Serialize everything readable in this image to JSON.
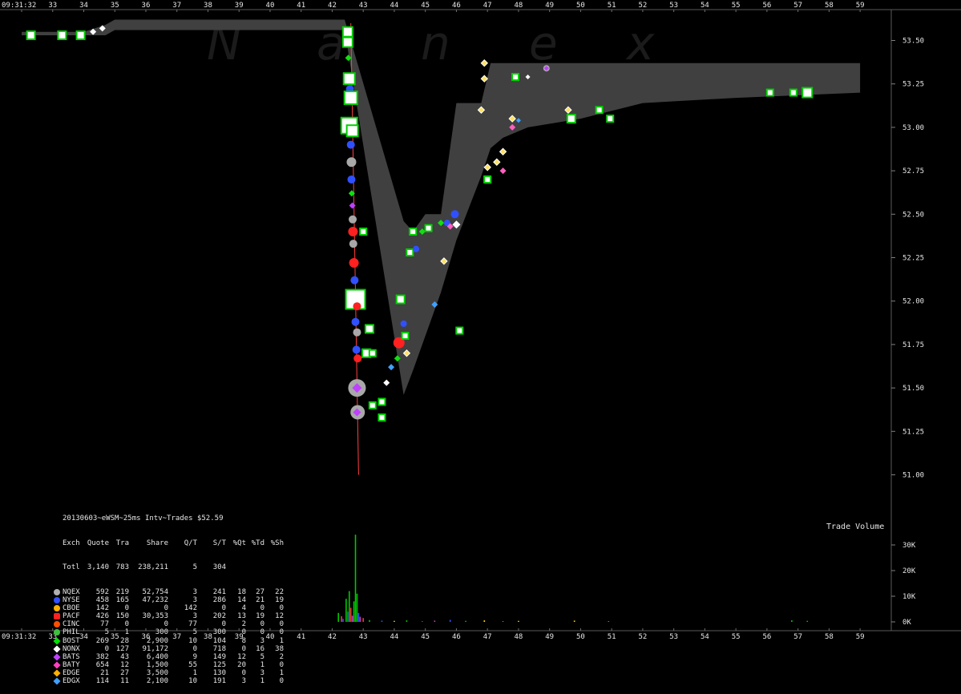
{
  "chart_data": {
    "type": "scatter",
    "title": "20130603~eWSM~25ms Intv~Trades $52.59",
    "watermark": "Nanex",
    "time_labels": [
      "09:31:32",
      "33",
      "34",
      "35",
      "36",
      "37",
      "38",
      "39",
      "40",
      "41",
      "42",
      "43",
      "44",
      "45",
      "46",
      "47",
      "48",
      "49",
      "50",
      "51",
      "52",
      "53",
      "54",
      "55",
      "56",
      "57",
      "58",
      "59"
    ],
    "x_ticks": [
      32,
      33,
      34,
      35,
      36,
      37,
      38,
      39,
      40,
      41,
      42,
      43,
      44,
      45,
      46,
      47,
      48,
      49,
      50,
      51,
      52,
      53,
      54,
      55,
      56,
      57,
      58,
      59
    ],
    "xlim": [
      32,
      59.9
    ],
    "price_ticks": [
      "53.50",
      "53.25",
      "53.00",
      "52.75",
      "52.50",
      "52.25",
      "52.00",
      "51.75",
      "51.50",
      "51.25",
      "51.00"
    ],
    "ylim": [
      50.85,
      53.65
    ],
    "volume_ticks": [
      "30K",
      "20K",
      "10K",
      "0K"
    ],
    "volume_label": "Trade Volume",
    "background": "#000000",
    "spread_color": "#404040",
    "nbbo_spread": [
      {
        "t": 32.0,
        "bid": 53.53,
        "ask": 53.55
      },
      {
        "t": 34.0,
        "bid": 53.53,
        "ask": 53.55
      },
      {
        "t": 34.7,
        "bid": 53.53,
        "ask": 53.59
      },
      {
        "t": 35.0,
        "bid": 53.56,
        "ask": 53.62
      },
      {
        "t": 37.0,
        "bid": 53.56,
        "ask": 53.62
      },
      {
        "t": 42.4,
        "bid": 53.56,
        "ask": 53.62
      },
      {
        "t": 44.3,
        "bid": 51.46,
        "ask": 52.46
      },
      {
        "t": 44.6,
        "bid": 51.6,
        "ask": 52.4
      },
      {
        "t": 45.0,
        "bid": 51.8,
        "ask": 52.5
      },
      {
        "t": 45.5,
        "bid": 52.05,
        "ask": 52.5
      },
      {
        "t": 46.0,
        "bid": 52.35,
        "ask": 53.14
      },
      {
        "t": 46.8,
        "bid": 52.72,
        "ask": 53.14
      },
      {
        "t": 47.1,
        "bid": 52.88,
        "ask": 53.37
      },
      {
        "t": 47.5,
        "bid": 52.94,
        "ask": 53.37
      },
      {
        "t": 48.3,
        "bid": 53.0,
        "ask": 53.37
      },
      {
        "t": 50.0,
        "bid": 53.05,
        "ask": 53.37
      },
      {
        "t": 52.0,
        "bid": 53.14,
        "ask": 53.37
      },
      {
        "t": 55.0,
        "bid": 53.17,
        "ask": 53.37
      },
      {
        "t": 59.0,
        "bid": 53.2,
        "ask": 53.37
      }
    ],
    "trades": [
      {
        "t": 32.3,
        "p": 53.53,
        "x": "NQEX_SQ",
        "s": 5
      },
      {
        "t": 33.3,
        "p": 53.53,
        "x": "NQEX_SQ",
        "s": 5
      },
      {
        "t": 33.9,
        "p": 53.53,
        "x": "NQEX_SQ",
        "s": 5
      },
      {
        "t": 34.3,
        "p": 53.55,
        "x": "NONX",
        "s": 4
      },
      {
        "t": 34.6,
        "p": 53.57,
        "x": "NONX",
        "s": 4
      },
      {
        "t": 42.5,
        "p": 53.55,
        "x": "NQEX_SQ",
        "s": 6
      },
      {
        "t": 42.5,
        "p": 53.49,
        "x": "NQEX_SQ",
        "s": 6
      },
      {
        "t": 42.52,
        "p": 53.4,
        "x": "BOST",
        "s": 4
      },
      {
        "t": 42.55,
        "p": 53.28,
        "x": "NQEX_SQ",
        "s": 7
      },
      {
        "t": 42.57,
        "p": 53.22,
        "x": "NYSE",
        "s": 5
      },
      {
        "t": 42.6,
        "p": 53.17,
        "x": "NQEX_SQ",
        "s": 8
      },
      {
        "t": 42.55,
        "p": 53.01,
        "x": "NQEX_SQ",
        "s": 10
      },
      {
        "t": 42.65,
        "p": 52.98,
        "x": "NQEX_SQ",
        "s": 7
      },
      {
        "t": 42.6,
        "p": 52.9,
        "x": "NYSE",
        "s": 5
      },
      {
        "t": 42.62,
        "p": 52.8,
        "x": "NQEX",
        "s": 6
      },
      {
        "t": 42.62,
        "p": 52.7,
        "x": "NYSE",
        "s": 5
      },
      {
        "t": 42.63,
        "p": 52.62,
        "x": "BOST",
        "s": 4
      },
      {
        "t": 42.65,
        "p": 52.55,
        "x": "BATS",
        "s": 4
      },
      {
        "t": 42.66,
        "p": 52.47,
        "x": "NQEX",
        "s": 5
      },
      {
        "t": 42.67,
        "p": 52.4,
        "x": "PACF",
        "s": 6
      },
      {
        "t": 42.68,
        "p": 52.33,
        "x": "NQEX",
        "s": 5
      },
      {
        "t": 42.7,
        "p": 52.22,
        "x": "PACF",
        "s": 6
      },
      {
        "t": 42.72,
        "p": 52.12,
        "x": "NYSE",
        "s": 5
      },
      {
        "t": 42.75,
        "p": 52.01,
        "x": "NQEX_SQ",
        "s": 12
      },
      {
        "t": 42.8,
        "p": 51.97,
        "x": "PACF",
        "s": 5
      },
      {
        "t": 42.75,
        "p": 51.88,
        "x": "NYSE",
        "s": 5
      },
      {
        "t": 42.8,
        "p": 51.82,
        "x": "NQEX",
        "s": 5
      },
      {
        "t": 42.78,
        "p": 51.72,
        "x": "NYSE",
        "s": 5
      },
      {
        "t": 42.82,
        "p": 51.67,
        "x": "PACF",
        "s": 5
      },
      {
        "t": 42.8,
        "p": 51.5,
        "x": "NQEX",
        "s": 11
      },
      {
        "t": 42.8,
        "p": 51.5,
        "x": "BATS",
        "s": 6
      },
      {
        "t": 42.82,
        "p": 51.36,
        "x": "NQEX",
        "s": 9
      },
      {
        "t": 42.8,
        "p": 51.36,
        "x": "BATS",
        "s": 5
      },
      {
        "t": 43.1,
        "p": 51.7,
        "x": "NQEX_SQ",
        "s": 5
      },
      {
        "t": 43.2,
        "p": 51.84,
        "x": "NQEX_SQ",
        "s": 5
      },
      {
        "t": 43.3,
        "p": 51.7,
        "x": "NQEX_SQ",
        "s": 4
      },
      {
        "t": 43.3,
        "p": 51.4,
        "x": "NQEX_SQ",
        "s": 4
      },
      {
        "t": 43.0,
        "p": 52.4,
        "x": "NQEX_SQ",
        "s": 4
      },
      {
        "t": 43.6,
        "p": 51.42,
        "x": "NQEX_SQ",
        "s": 4
      },
      {
        "t": 43.6,
        "p": 51.33,
        "x": "NQEX_SQ",
        "s": 4
      },
      {
        "t": 43.75,
        "p": 51.53,
        "x": "NONX",
        "s": 4
      },
      {
        "t": 43.9,
        "p": 51.62,
        "x": "EDGX",
        "s": 4
      },
      {
        "t": 44.1,
        "p": 51.67,
        "x": "BOST",
        "s": 4
      },
      {
        "t": 44.2,
        "p": 52.01,
        "x": "NQEX_SQ",
        "s": 5
      },
      {
        "t": 44.15,
        "p": 51.76,
        "x": "PACF",
        "s": 7
      },
      {
        "t": 44.3,
        "p": 51.87,
        "x": "NYSE",
        "s": 4
      },
      {
        "t": 44.35,
        "p": 51.8,
        "x": "NQEX_SQ",
        "s": 4
      },
      {
        "t": 44.4,
        "p": 51.7,
        "x": "EDGE",
        "s": 4
      },
      {
        "t": 44.5,
        "p": 52.28,
        "x": "NQEX_SQ",
        "s": 4
      },
      {
        "t": 44.6,
        "p": 52.4,
        "x": "NQEX_SQ",
        "s": 4
      },
      {
        "t": 44.7,
        "p": 52.3,
        "x": "NYSE",
        "s": 4
      },
      {
        "t": 44.9,
        "p": 52.4,
        "x": "BOST",
        "s": 4
      },
      {
        "t": 45.1,
        "p": 52.42,
        "x": "NQEX_SQ",
        "s": 4
      },
      {
        "t": 45.3,
        "p": 51.98,
        "x": "EDGX",
        "s": 4
      },
      {
        "t": 45.5,
        "p": 52.45,
        "x": "BOST",
        "s": 4
      },
      {
        "t": 45.6,
        "p": 52.23,
        "x": "EDGE",
        "s": 4
      },
      {
        "t": 45.7,
        "p": 52.45,
        "x": "NYSE",
        "s": 4
      },
      {
        "t": 45.8,
        "p": 52.43,
        "x": "BATY",
        "s": 4
      },
      {
        "t": 46.0,
        "p": 52.44,
        "x": "NONX",
        "s": 5
      },
      {
        "t": 46.1,
        "p": 51.83,
        "x": "NQEX_SQ",
        "s": 4
      },
      {
        "t": 45.95,
        "p": 52.5,
        "x": "NYSE",
        "s": 5
      },
      {
        "t": 46.8,
        "p": 53.1,
        "x": "EDGE",
        "s": 4
      },
      {
        "t": 46.9,
        "p": 53.37,
        "x": "EDGE",
        "s": 4
      },
      {
        "t": 46.9,
        "p": 53.28,
        "x": "EDGE",
        "s": 4
      },
      {
        "t": 47.0,
        "p": 52.77,
        "x": "EDGE",
        "s": 4
      },
      {
        "t": 47.0,
        "p": 52.7,
        "x": "NQEX_SQ",
        "s": 4
      },
      {
        "t": 47.3,
        "p": 52.8,
        "x": "EDGE",
        "s": 4
      },
      {
        "t": 47.5,
        "p": 52.86,
        "x": "EDGE",
        "s": 4
      },
      {
        "t": 47.5,
        "p": 52.75,
        "x": "BATY",
        "s": 4
      },
      {
        "t": 47.8,
        "p": 53.05,
        "x": "EDGE",
        "s": 4
      },
      {
        "t": 47.8,
        "p": 53.0,
        "x": "BATY",
        "s": 4
      },
      {
        "t": 48.0,
        "p": 53.04,
        "x": "EDGX",
        "s": 3
      },
      {
        "t": 47.9,
        "p": 53.29,
        "x": "NQEX_SQ",
        "s": 4
      },
      {
        "t": 48.3,
        "p": 53.29,
        "x": "NONX",
        "s": 3
      },
      {
        "t": 48.9,
        "p": 53.34,
        "x": "NQEX",
        "s": 4
      },
      {
        "t": 48.9,
        "p": 53.34,
        "x": "BATS",
        "s": 3
      },
      {
        "t": 49.6,
        "p": 53.1,
        "x": "EDGE",
        "s": 4
      },
      {
        "t": 49.7,
        "p": 53.05,
        "x": "NQEX_SQ",
        "s": 5
      },
      {
        "t": 50.6,
        "p": 53.1,
        "x": "NQEX_SQ",
        "s": 4
      },
      {
        "t": 50.95,
        "p": 53.05,
        "x": "NQEX_SQ",
        "s": 4
      },
      {
        "t": 56.1,
        "p": 53.2,
        "x": "NQEX_SQ",
        "s": 4
      },
      {
        "t": 56.85,
        "p": 53.2,
        "x": "NQEX_SQ",
        "s": 4
      },
      {
        "t": 57.3,
        "p": 53.2,
        "x": "NQEX_SQ",
        "s": 6
      }
    ],
    "volume": [
      {
        "t": 42.2,
        "v": 3500,
        "c": "#00c800"
      },
      {
        "t": 42.3,
        "v": 2200,
        "c": "#ff3030"
      },
      {
        "t": 42.35,
        "v": 1200,
        "c": "#3050ff"
      },
      {
        "t": 42.45,
        "v": 9000,
        "c": "#00c800"
      },
      {
        "t": 42.5,
        "v": 4000,
        "c": "#3050ff"
      },
      {
        "t": 42.55,
        "v": 12000,
        "c": "#00c800"
      },
      {
        "t": 42.6,
        "v": 5500,
        "c": "#ff3030"
      },
      {
        "t": 42.65,
        "v": 2400,
        "c": "#c040c0"
      },
      {
        "t": 42.7,
        "v": 8000,
        "c": "#00c800"
      },
      {
        "t": 42.75,
        "v": 34000,
        "c": "#00c800"
      },
      {
        "t": 42.8,
        "v": 11000,
        "c": "#00c800"
      },
      {
        "t": 42.85,
        "v": 3500,
        "c": "#3050ff"
      },
      {
        "t": 42.9,
        "v": 2000,
        "c": "#c040c0"
      },
      {
        "t": 43.0,
        "v": 1500,
        "c": "#ff3030"
      },
      {
        "t": 43.2,
        "v": 700,
        "c": "#00c800"
      },
      {
        "t": 43.6,
        "v": 500,
        "c": "#3050ff"
      },
      {
        "t": 44.0,
        "v": 400,
        "c": "#ffd000"
      },
      {
        "t": 44.4,
        "v": 600,
        "c": "#00c800"
      },
      {
        "t": 44.9,
        "v": 300,
        "c": "#3050ff"
      },
      {
        "t": 45.3,
        "v": 500,
        "c": "#c040c0"
      },
      {
        "t": 45.8,
        "v": 800,
        "c": "#3050ff"
      },
      {
        "t": 46.3,
        "v": 400,
        "c": "#00c800"
      },
      {
        "t": 46.9,
        "v": 600,
        "c": "#ffd000"
      },
      {
        "t": 47.5,
        "v": 300,
        "c": "#00c800"
      },
      {
        "t": 48.0,
        "v": 400,
        "c": "#ffd000"
      },
      {
        "t": 49.8,
        "v": 500,
        "c": "#ffd000"
      },
      {
        "t": 50.9,
        "v": 300,
        "c": "#00c800"
      },
      {
        "t": 56.8,
        "v": 600,
        "c": "#00c800"
      },
      {
        "t": 57.3,
        "v": 400,
        "c": "#00c800"
      }
    ]
  },
  "stats": {
    "header": {
      "exch": "Exch",
      "quote": "Quote",
      "tra": "Tra",
      "share": "Share",
      "qt": "Q/T",
      "st": "S/T",
      "pqt": "%Qt",
      "ptd": "%Td",
      "psh": "%Sh"
    },
    "total": {
      "exch": "Totl",
      "quote": "3,140",
      "tra": "783",
      "share": "238,211",
      "qt": "5",
      "st": "304",
      "pqt": "",
      "ptd": "",
      "psh": ""
    },
    "rows": [
      {
        "sym": "circle",
        "color": "#b0b0b0",
        "exch": "NQEX",
        "quote": "592",
        "tra": "219",
        "share": "52,754",
        "qt": "3",
        "st": "241",
        "pqt": "18",
        "ptd": "27",
        "psh": "22"
      },
      {
        "sym": "circle",
        "color": "#3050ff",
        "exch": "NYSE",
        "quote": "458",
        "tra": "165",
        "share": "47,232",
        "qt": "3",
        "st": "286",
        "pqt": "14",
        "ptd": "21",
        "psh": "19"
      },
      {
        "sym": "circle",
        "color": "#ffb000",
        "exch": "CBOE",
        "quote": "142",
        "tra": "0",
        "share": "0",
        "qt": "142",
        "st": "0",
        "pqt": "4",
        "ptd": "0",
        "psh": "0"
      },
      {
        "sym": "hex",
        "color": "#ff2020",
        "exch": "PACF",
        "quote": "426",
        "tra": "150",
        "share": "30,353",
        "qt": "3",
        "st": "202",
        "pqt": "13",
        "ptd": "19",
        "psh": "12"
      },
      {
        "sym": "circle",
        "color": "#ff5000",
        "exch": "CINC",
        "quote": "77",
        "tra": "0",
        "share": "0",
        "qt": "77",
        "st": "0",
        "pqt": "2",
        "ptd": "0",
        "psh": "0"
      },
      {
        "sym": "circle",
        "color": "#40c040",
        "exch": "PHIL",
        "quote": "5",
        "tra": "1",
        "share": "300",
        "qt": "5",
        "st": "300",
        "pqt": "0",
        "ptd": "0",
        "psh": "0"
      },
      {
        "sym": "diamond",
        "color": "#00e000",
        "exch": "BOST",
        "quote": "269",
        "tra": "28",
        "share": "2,900",
        "qt": "10",
        "st": "104",
        "pqt": "8",
        "ptd": "3",
        "psh": "1"
      },
      {
        "sym": "diamond",
        "color": "#ffffff",
        "exch": "NONX",
        "quote": "0",
        "tra": "127",
        "share": "91,172",
        "qt": "0",
        "st": "718",
        "pqt": "0",
        "ptd": "16",
        "psh": "38"
      },
      {
        "sym": "diamond",
        "color": "#c040ff",
        "exch": "BATS",
        "quote": "382",
        "tra": "43",
        "share": "6,400",
        "qt": "9",
        "st": "149",
        "pqt": "12",
        "ptd": "5",
        "psh": "2"
      },
      {
        "sym": "diamond",
        "color": "#ff40c0",
        "exch": "BATY",
        "quote": "654",
        "tra": "12",
        "share": "1,500",
        "qt": "55",
        "st": "125",
        "pqt": "20",
        "ptd": "1",
        "psh": "0"
      },
      {
        "sym": "diamond",
        "color": "#ffb000",
        "exch": "EDGE",
        "quote": "21",
        "tra": "27",
        "share": "3,500",
        "qt": "1",
        "st": "130",
        "pqt": "0",
        "ptd": "3",
        "psh": "1"
      },
      {
        "sym": "diamond",
        "color": "#40a0ff",
        "exch": "EDGX",
        "quote": "114",
        "tra": "11",
        "share": "2,100",
        "qt": "10",
        "st": "191",
        "pqt": "3",
        "ptd": "1",
        "psh": "0"
      }
    ]
  }
}
